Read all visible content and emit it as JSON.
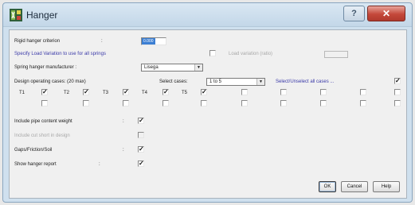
{
  "window": {
    "title": "Hanger",
    "icon": "hanger-app-icon",
    "help_glyph": "?",
    "close_glyph": "✕"
  },
  "rigid": {
    "label": "Rigid hanger criterion",
    "colon": ":",
    "value": "0.000"
  },
  "load_variation": {
    "label": "Specify Load Variation to use for all springs",
    "disabled_label": "Load variation (ratio)"
  },
  "manufacturer": {
    "label": "Spring hanger manufacturer :",
    "value": "Lisega",
    "arrow": "▼"
  },
  "cases": {
    "label": "Design operating cases: (20 max)",
    "select_label": "Select cases:",
    "select_value": "1 to 5",
    "select_arrow": "▼",
    "select_all_label": "Select/Unselect all cases ...",
    "row1": [
      {
        "label": "T1",
        "checked": true
      },
      {
        "label": "T2",
        "checked": true
      },
      {
        "label": "T3",
        "checked": true
      },
      {
        "label": "T4",
        "checked": true
      },
      {
        "label": "T5",
        "checked": true
      }
    ],
    "check_glyph": "✓"
  },
  "options": [
    {
      "label": "Include pipe content weight",
      "colon": ":",
      "checked": true,
      "disabled": false
    },
    {
      "label": "Include cut short in design",
      "colon": "",
      "checked": false,
      "disabled": true
    },
    {
      "label": "Gaps/Friction/Soil",
      "colon": ":",
      "checked": true,
      "disabled": false
    },
    {
      "label": "Show hanger report",
      "colon": ":",
      "checked": true,
      "disabled": false
    }
  ],
  "buttons": {
    "ok": "OK",
    "cancel": "Cancel",
    "help": "Help"
  }
}
